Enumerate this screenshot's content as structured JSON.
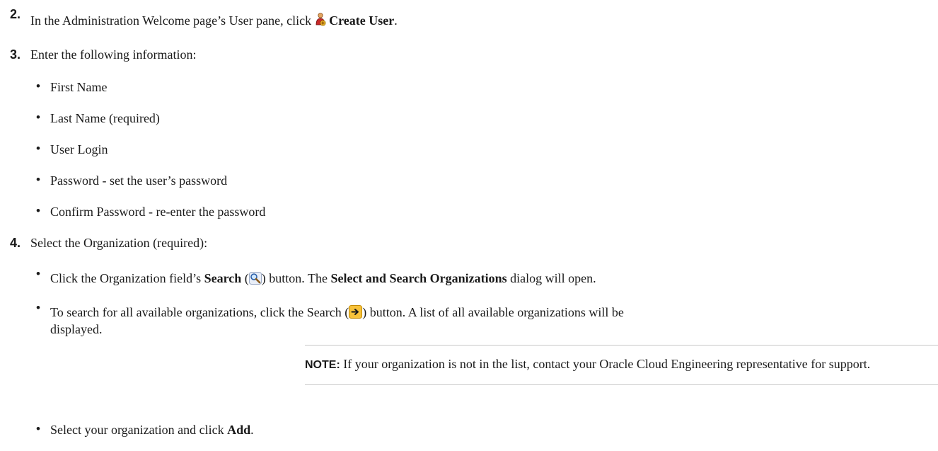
{
  "steps": [
    {
      "num": "2.",
      "text_before": "In the Administration Welcome page’s User pane, click ",
      "icon": "create-user-icon",
      "bold": "Create User",
      "text_after": "."
    },
    {
      "num": "3.",
      "text": "Enter the following information:",
      "items": [
        "First Name",
        "Last Name (required)",
        "User Login",
        "Password - set the user’s password",
        "Confirm Password - re-enter the password"
      ]
    },
    {
      "num": "4.",
      "text": "Select the Organization (required):",
      "sub1": {
        "a": "Click the Organization field’s ",
        "b": "Search",
        "c": " (",
        "icon": "magnifier-icon",
        "d": ") button. The ",
        "e": "Select and Search Organizations",
        "f": " dialog will open."
      },
      "sub2": {
        "a": "To search for all available organizations, click the Search (",
        "icon": "arrow-right-icon",
        "b": ") button. A list of all available organizations will be",
        "c": "displayed."
      },
      "note": {
        "label": "NOTE:",
        "text": " If your organization is not in the list, contact your Oracle Cloud Engineering representative for support."
      },
      "sub3": {
        "a": "Select your organization and click ",
        "b": "Add",
        "c": "."
      }
    }
  ],
  "bullet_char": "•"
}
